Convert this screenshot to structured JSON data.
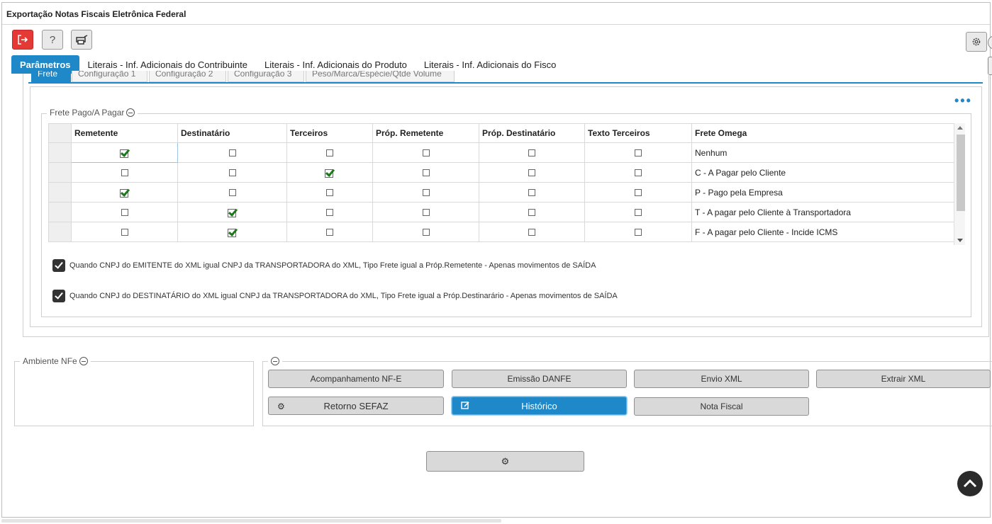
{
  "window": {
    "title": "Exportação Notas Fiscais Eletrônica Federal"
  },
  "toolbar": {
    "exit_icon": "exit-icon",
    "help_label": "?",
    "printer_icon": "printer-icon",
    "settings_icon": "gear-icon",
    "colors": {
      "exit": "#e53935",
      "accent": "#1e88c8"
    }
  },
  "tabs": [
    {
      "label": "Parâmetros",
      "active": true
    },
    {
      "label": "Literais - Inf. Adicionais do Contribuinte"
    },
    {
      "label": "Literais - Inf. Adicionais do Produto"
    },
    {
      "label": "Literais - Inf. Adicionais do Fisco"
    }
  ],
  "subtabs": [
    {
      "label": "Frete",
      "active": true
    },
    {
      "label": "Configuração 1"
    },
    {
      "label": "Configuração 2"
    },
    {
      "label": "Configuração 3"
    },
    {
      "label": "Peso/Marca/Espécie/Qtde Volume"
    }
  ],
  "frete": {
    "legend": "Frete Pago/A Pagar",
    "columns": [
      "Remetente",
      "Destinatário",
      "Terceiros",
      "Próp. Remetente",
      "Próp. Destinatário",
      "Texto Terceiros",
      "Frete Omega"
    ],
    "rows": [
      {
        "checks": [
          true,
          false,
          false,
          false,
          false,
          false
        ],
        "frete_omega": "Nenhum"
      },
      {
        "checks": [
          false,
          false,
          true,
          false,
          false,
          false
        ],
        "frete_omega": "C - A Pagar pelo Cliente"
      },
      {
        "checks": [
          true,
          false,
          false,
          false,
          false,
          false
        ],
        "frete_omega": "P - Pago pela Empresa"
      },
      {
        "checks": [
          false,
          true,
          false,
          false,
          false,
          false
        ],
        "frete_omega": "T - A pagar pelo Cliente à Transportadora"
      },
      {
        "checks": [
          false,
          true,
          false,
          false,
          false,
          false
        ],
        "frete_omega": "F - A pagar pelo Cliente - Incide ICMS"
      }
    ],
    "option1": {
      "label": "Quando CNPJ do EMITENTE do XML igual CNPJ da TRANSPORTADORA do XML, Tipo Frete igual a Próp.Remetente - Apenas movimentos de SAÍDA",
      "checked": true
    },
    "option2": {
      "label": "Quando CNPJ do DESTINATÁRIO do XML igual CNPJ da TRANSPORTADORA do XML, Tipo Frete igual a Próp.Destinarário - Apenas movimentos de SAÍDA",
      "checked": true
    }
  },
  "ambiente": {
    "legend": "Ambiente NFe"
  },
  "actions": {
    "acompanhamento": "Acompanhamento NF-E",
    "emissao": "Emissão DANFE",
    "envio": "Envio XML",
    "extrair": "Extrair XML",
    "retorno": "Retorno SEFAZ",
    "historico": "Histórico",
    "nota": "Nota Fiscal"
  }
}
